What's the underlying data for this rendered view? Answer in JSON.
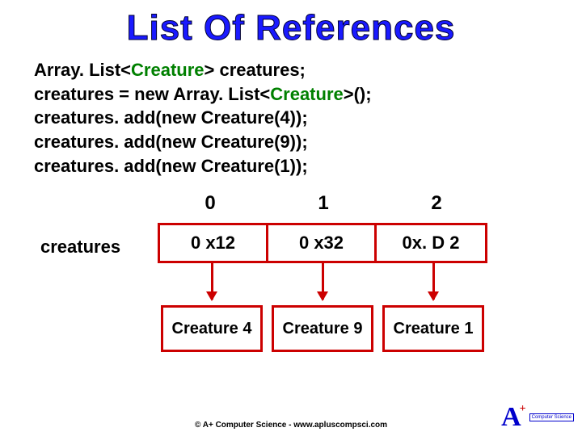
{
  "title": "List Of References",
  "code": {
    "l1a": "Array. List<",
    "l1b": "Creature",
    "l1c": "> creatures;",
    "l2a": "creatures  = new Array. List<",
    "l2b": "Creature",
    "l2c": ">();",
    "l3": "creatures. add(new Creature(4));",
    "l4": "creatures. add(new Creature(9));",
    "l5": "creatures. add(new Creature(1));"
  },
  "diagram": {
    "label": "creatures",
    "indices": [
      "0",
      "1",
      "2"
    ],
    "refs": [
      "0 x12",
      "0 x32",
      "0x. D 2"
    ],
    "objs": [
      "Creature 4",
      "Creature 9",
      "Creature 1"
    ]
  },
  "footer": "© A+ Computer Science  -  www.apluscompsci.com",
  "logo": {
    "letter": "A",
    "plus": "+",
    "text": "Computer Science"
  }
}
